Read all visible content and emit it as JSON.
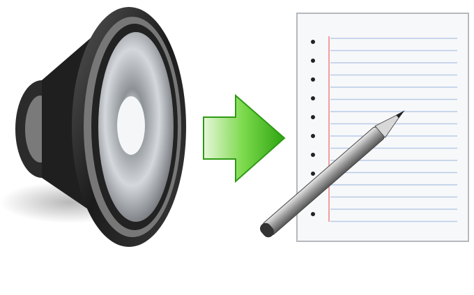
{
  "illustration": {
    "icons": [
      "speaker-icon",
      "arrow-right-icon",
      "notepad-icon",
      "pencil-icon"
    ],
    "colors": {
      "speaker_rim": "#2a2a2a",
      "speaker_cone": "#c8ccd0",
      "arrow_green": "#3fbf1f",
      "paper": "#f7f8fa",
      "paper_lines": "#b9cbe6",
      "margin_line": "#f08080",
      "pencil_body": "#9a9a9a"
    }
  }
}
